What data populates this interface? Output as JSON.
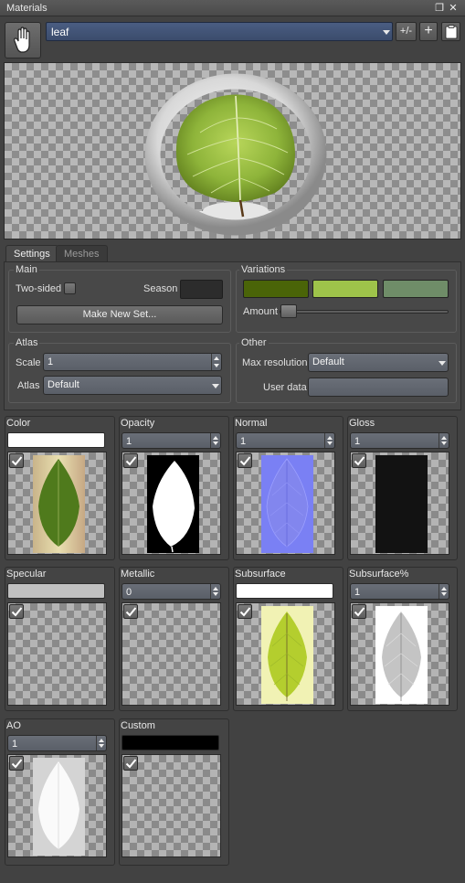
{
  "window": {
    "title": "Materials"
  },
  "toolbar": {
    "material_name": "leaf",
    "plus_minus_label": "+/-",
    "add_icon": "plus-icon",
    "paste_icon": "clipboard-icon",
    "hand_icon": "hand-icon"
  },
  "tabs": [
    {
      "label": "Settings",
      "active": true
    },
    {
      "label": "Meshes",
      "active": false
    }
  ],
  "main": {
    "label": "Main",
    "two_sided_label": "Two-sided",
    "season_label": "Season",
    "make_new_set_label": "Make New Set..."
  },
  "variations": {
    "label": "Variations",
    "colors": [
      "#4a6408",
      "#9ec34a",
      "#6f8d68"
    ],
    "amount_label": "Amount",
    "amount_value": 0
  },
  "atlas": {
    "label": "Atlas",
    "scale_label": "Scale",
    "scale_value": "1",
    "atlas_label": "Atlas",
    "atlas_value": "Default"
  },
  "other": {
    "label": "Other",
    "max_resolution_label": "Max resolution",
    "max_resolution_value": "Default",
    "user_data_label": "User data",
    "user_data_value": ""
  },
  "maps": [
    {
      "label": "Color",
      "kind": "swatch",
      "swatch": "#ffffff",
      "checked": true,
      "image": "leaf-color"
    },
    {
      "label": "Opacity",
      "kind": "number",
      "value": "1",
      "checked": true,
      "image": "leaf-opacity"
    },
    {
      "label": "Normal",
      "kind": "number",
      "value": "1",
      "checked": true,
      "image": "leaf-normal"
    },
    {
      "label": "Gloss",
      "kind": "number",
      "value": "1",
      "checked": true,
      "image": "leaf-gloss"
    },
    {
      "label": "Specular",
      "kind": "swatch",
      "swatch": "#c0c0c0",
      "checked": true,
      "image": ""
    },
    {
      "label": "Metallic",
      "kind": "number",
      "value": "0",
      "checked": true,
      "image": ""
    },
    {
      "label": "Subsurface",
      "kind": "swatch",
      "swatch": "#ffffff",
      "checked": true,
      "image": "leaf-subsurface"
    },
    {
      "label": "Subsurface%",
      "kind": "number",
      "value": "1",
      "checked": true,
      "image": "leaf-subsurface-pct"
    },
    {
      "label": "AO",
      "kind": "number",
      "value": "1",
      "checked": true,
      "image": "leaf-ao"
    },
    {
      "label": "Custom",
      "kind": "swatch",
      "swatch": "#000000",
      "checked": true,
      "image": ""
    }
  ]
}
